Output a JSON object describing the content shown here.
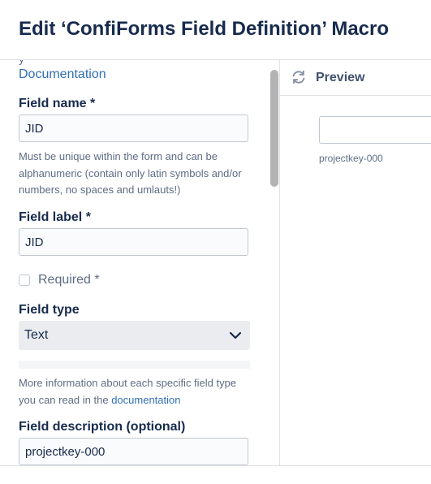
{
  "dialog": {
    "title": "Edit ‘ConfiForms Field Definition’ Macro"
  },
  "left_panel": {
    "clipped_text": "y",
    "doc_link": "Documentation",
    "field_name": {
      "label": "Field name *",
      "value": "JID",
      "help": "Must be unique within the form and can be alphanumeric (contain only latin symbols and/or numbers, no spaces and umlauts!)"
    },
    "field_label": {
      "label": "Field label *",
      "value": "JID"
    },
    "required": {
      "label": "Required *",
      "checked": false
    },
    "field_type": {
      "label": "Field type",
      "value": "Text",
      "help_prefix": "More information about each specific field type you can read in the ",
      "help_link": "documentation"
    },
    "field_description": {
      "label": "Field description (optional)",
      "value": "projectkey-000"
    }
  },
  "preview": {
    "title": "Preview",
    "input_value": "",
    "help_text": "projectkey-000"
  },
  "icons": {
    "refresh": "refresh-icon",
    "chevron": "chevron-down-icon"
  },
  "colors": {
    "link": "#2f6fb3",
    "text": "#172b4d",
    "muted": "#5e6c84",
    "select_bg": "#ebecf0"
  }
}
